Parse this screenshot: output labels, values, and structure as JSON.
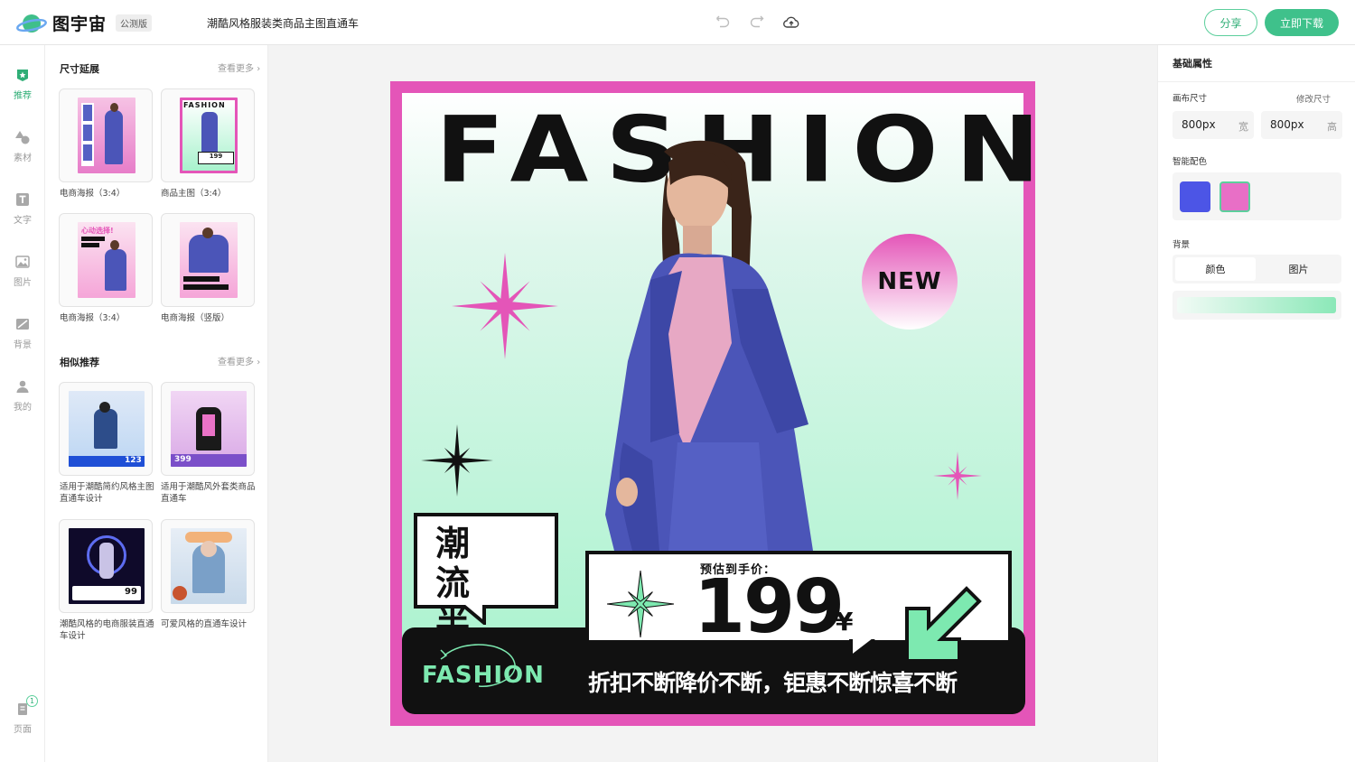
{
  "app": {
    "name": "图宇宙",
    "badge": "公测版",
    "doc_title": "潮酷风格服装类商品主图直通车"
  },
  "header": {
    "share_label": "分享",
    "download_label": "立即下载"
  },
  "leftnav": {
    "items": [
      {
        "label": "推荐",
        "icon": "recommend-icon"
      },
      {
        "label": "素材",
        "icon": "shapes-icon"
      },
      {
        "label": "文字",
        "icon": "text-icon"
      },
      {
        "label": "图片",
        "icon": "image-icon"
      },
      {
        "label": "背景",
        "icon": "background-icon"
      },
      {
        "label": "我的",
        "icon": "user-icon"
      }
    ],
    "page_label": "页面",
    "page_count": "1"
  },
  "panel": {
    "size_section": {
      "title": "尺寸延展",
      "more": "查看更多",
      "items": [
        {
          "caption": "电商海报（3:4）"
        },
        {
          "caption": "商品主图（3:4）"
        },
        {
          "caption": "电商海报（3:4）"
        },
        {
          "caption": "电商海报（竖版）"
        }
      ]
    },
    "similar_section": {
      "title": "相似推荐",
      "more": "查看更多",
      "items": [
        {
          "caption": "适用于潮酷简约风格主图直通车设计"
        },
        {
          "caption": "适用于潮酷风外套类商品直通车"
        },
        {
          "caption": "潮酷风格的电商服装直通车设计"
        },
        {
          "caption": "可爱风格的直通车设计"
        }
      ]
    }
  },
  "canvas": {
    "headline": "FASHION",
    "badge": "NEW",
    "tag": "潮 流 半 裙",
    "price_label": "预估到手价：",
    "price": "199",
    "currency": "¥",
    "brand_small": "FASHION",
    "slogan": "折扣不断降价不断，钜惠不断惊喜不断",
    "colors": {
      "frame": "#e455b8",
      "mint": "#a8f2cd",
      "jacket": "#4b55b8",
      "dark": "#111111"
    }
  },
  "rpanel": {
    "title": "基础属性",
    "canvas_size_label": "画布尺寸",
    "resize_link": "修改尺寸",
    "width_value": "800px",
    "width_unit": "宽",
    "height_value": "800px",
    "height_unit": "高",
    "smart_color_label": "智能配色",
    "swatches": [
      "#4c55e6",
      "#e86fc6"
    ],
    "background_label": "背景",
    "tabs": [
      "颜色",
      "图片"
    ]
  }
}
